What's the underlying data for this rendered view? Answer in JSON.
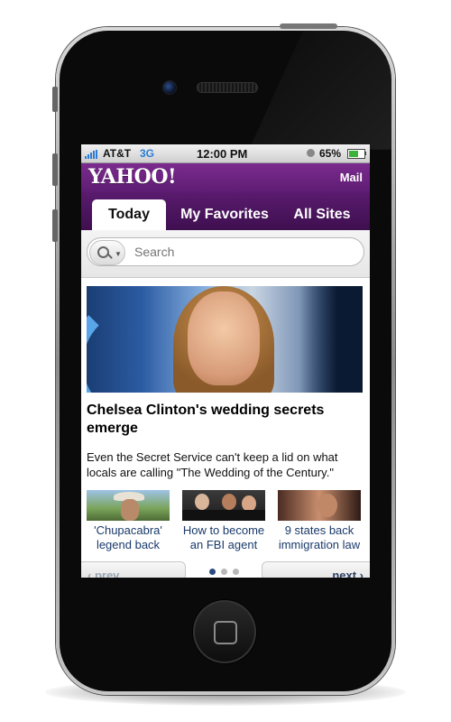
{
  "status_bar": {
    "carrier": "AT&T",
    "network": "3G",
    "time": "12:00 PM",
    "battery": "65%",
    "battery_level": 0.65,
    "icons": [
      "signal-icon",
      "lock-icon",
      "battery-icon"
    ]
  },
  "header": {
    "logo": "YAHOO!",
    "mail_label": "Mail"
  },
  "tabs": [
    {
      "label": "Today",
      "active": true
    },
    {
      "label": "My Favorites",
      "active": false
    },
    {
      "label": "All Sites",
      "active": false
    }
  ],
  "search": {
    "placeholder": "Search",
    "icon": "search-icon"
  },
  "main_story": {
    "headline": "Chelsea Clinton's wedding secrets emerge",
    "summary": "Even the Secret Service can't keep a lid on what locals are calling \"The Wedding of the Century.\""
  },
  "related": [
    {
      "caption": "'Chupacabra' legend back"
    },
    {
      "caption": "How to become an FBI agent"
    },
    {
      "caption": "9 states back immigration law"
    }
  ],
  "pager": {
    "prev_label": "‹ prev",
    "next_label": "next ›",
    "page_count": 3,
    "current_page": 1
  },
  "colors": {
    "brand_purple": "#6a237e",
    "tab_bar": "#4a1560",
    "link_blue": "#1a3a6a",
    "network_blue": "#2a7cd6"
  }
}
